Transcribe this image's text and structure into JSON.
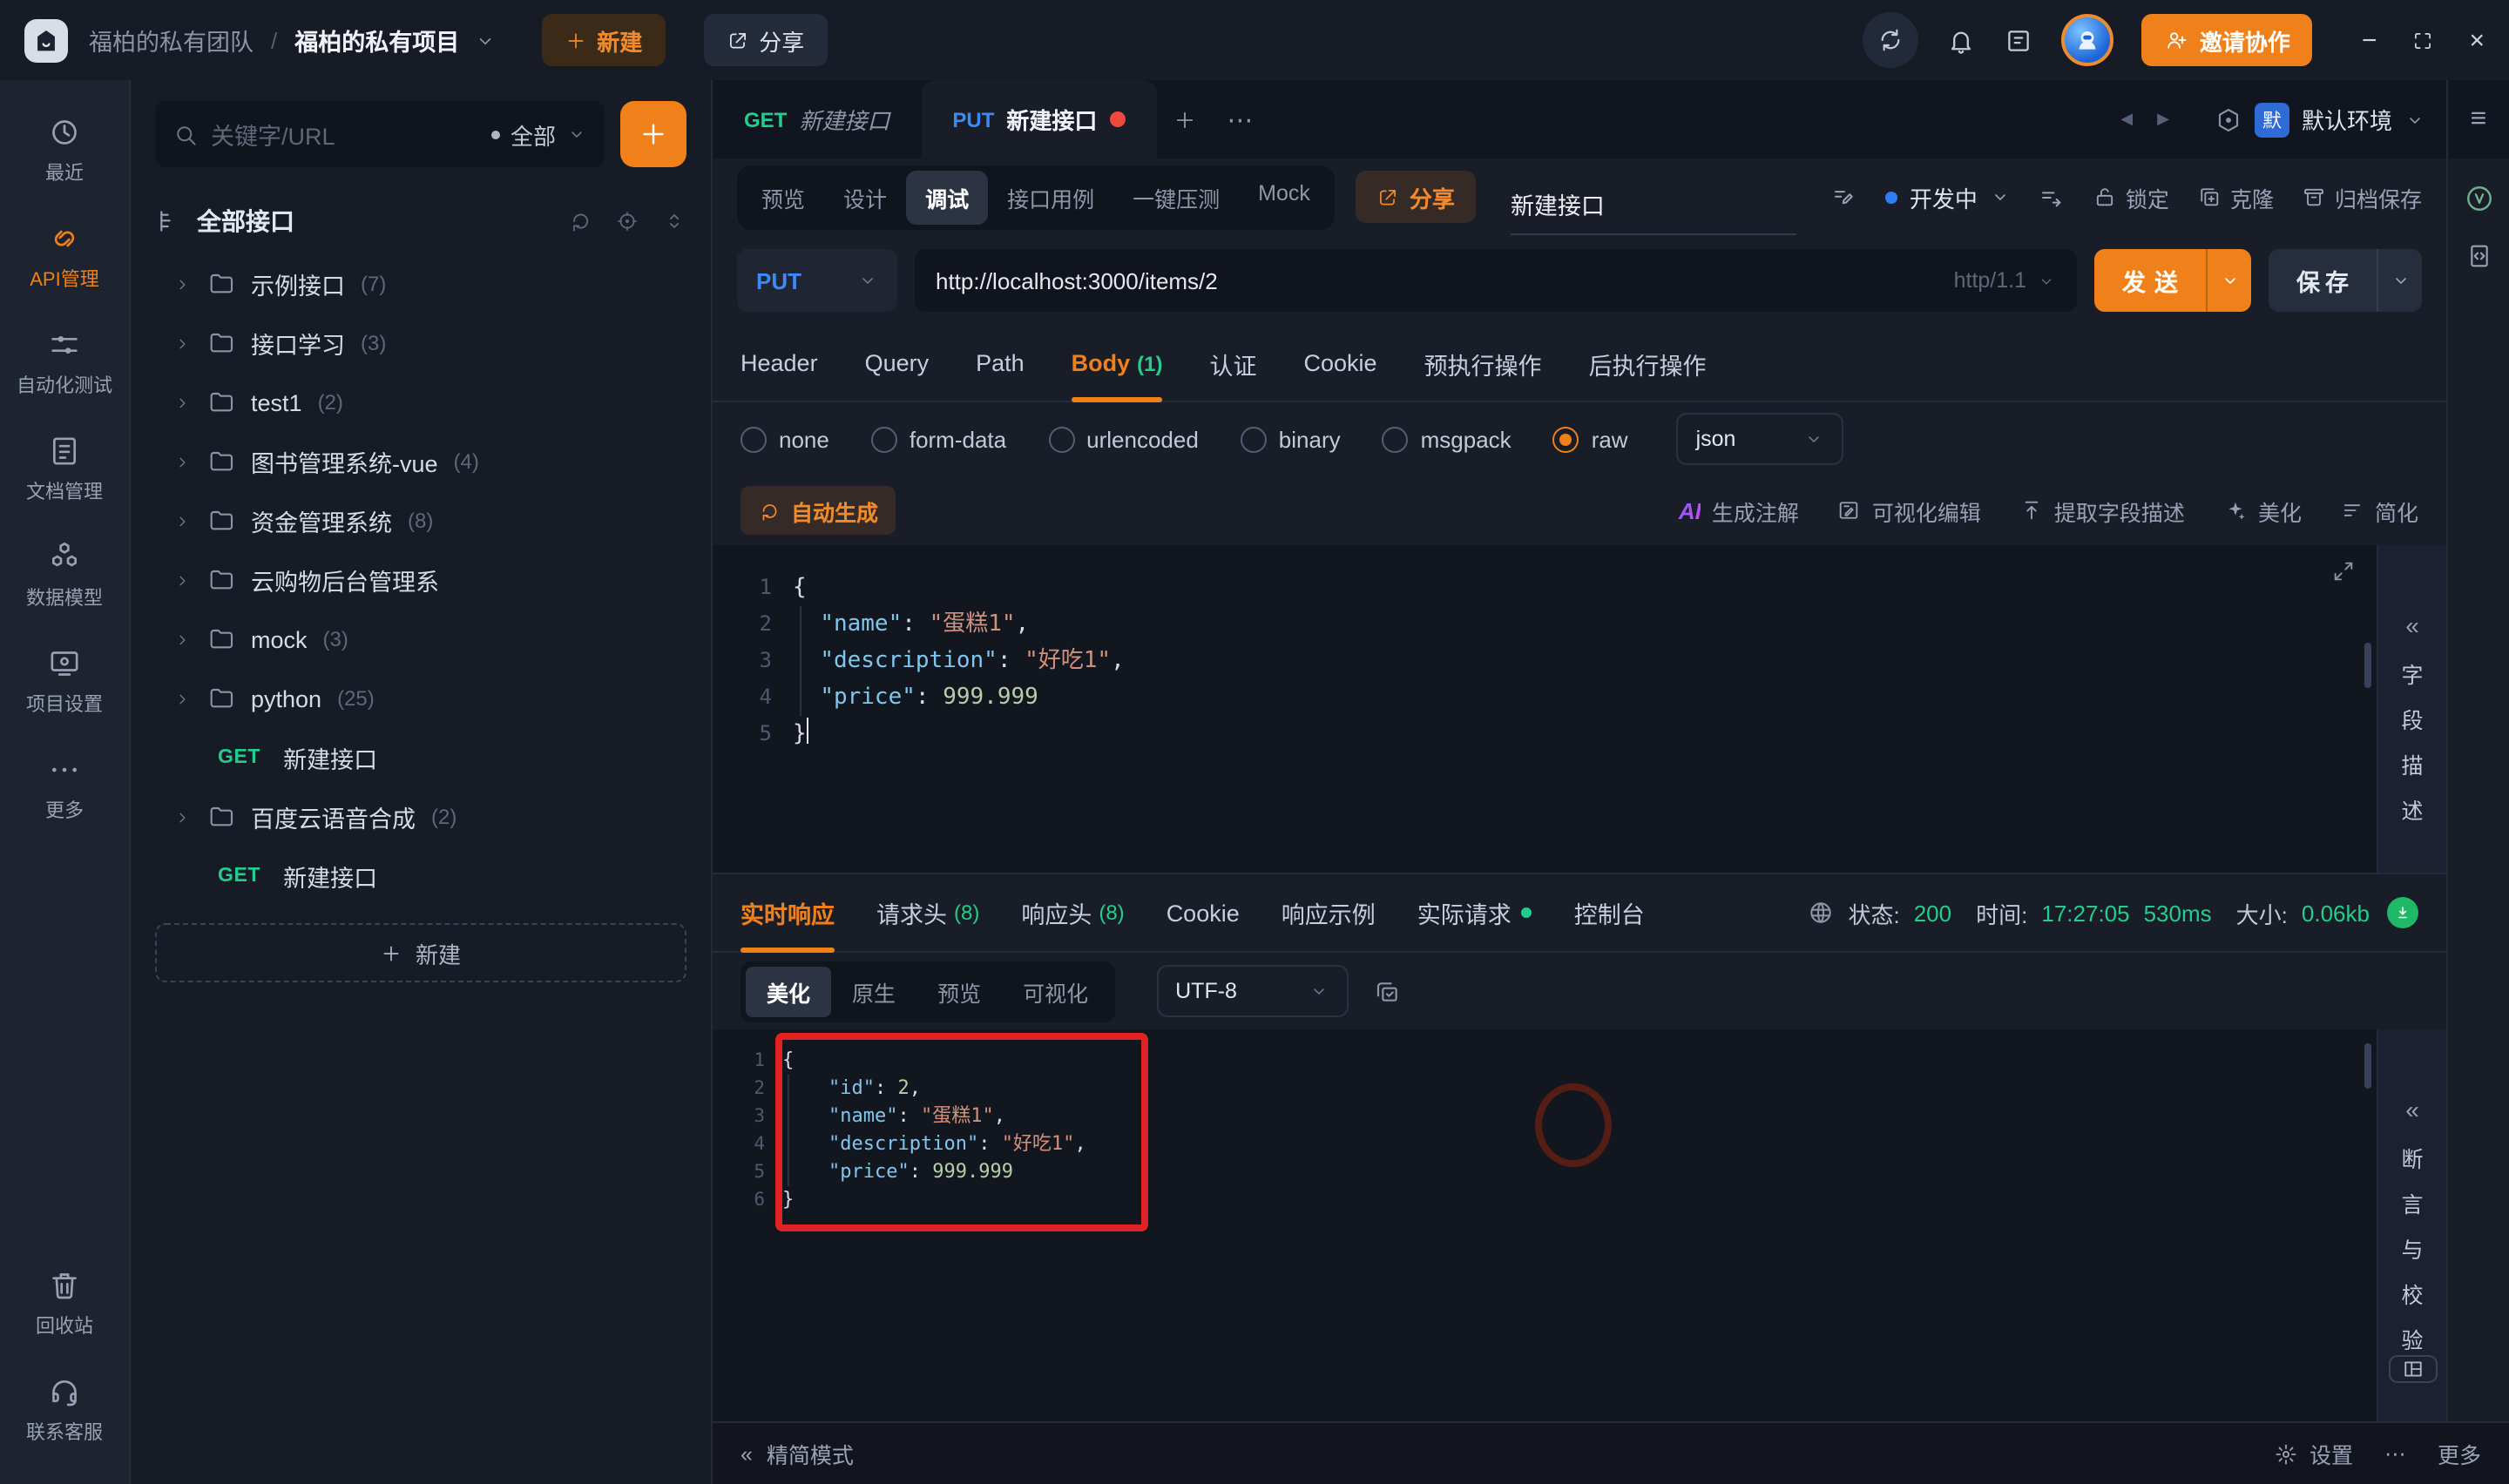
{
  "colors": {
    "accent_orange": "#F0801A",
    "method_get_green": "#23CE8C",
    "method_put_blue": "#3B8AF7",
    "success_green": "#23CE8C",
    "tab_dirty_red": "#F0483E",
    "annotation_red": "#E02222",
    "env_badge_blue": "#2E6BD6"
  },
  "topbar": {
    "team": "福柏的私有团队",
    "separator": "/",
    "project": "福柏的私有项目",
    "new_button": "新建",
    "share_button": "分享",
    "invite_button": "邀请协作"
  },
  "rail": {
    "items": [
      {
        "icon": "clock",
        "label": "最近",
        "active": false
      },
      {
        "icon": "api",
        "label": "API管理",
        "active": true
      },
      {
        "icon": "test",
        "label": "自动化测试",
        "active": false
      },
      {
        "icon": "doc",
        "label": "文档管理",
        "active": false
      },
      {
        "icon": "model",
        "label": "数据模型",
        "active": false
      },
      {
        "icon": "settings",
        "label": "项目设置",
        "active": false
      },
      {
        "icon": "dots",
        "label": "更多",
        "active": false
      }
    ],
    "bottom_items": [
      {
        "icon": "trash",
        "label": "回收站"
      },
      {
        "icon": "headset",
        "label": "联系客服"
      }
    ]
  },
  "sidebar": {
    "search_placeholder": "关键字/URL",
    "filter": "全部",
    "tree_header": "全部接口",
    "items": [
      {
        "kind": "folder",
        "name": "示例接口",
        "count": "(7)"
      },
      {
        "kind": "folder",
        "name": "接口学习",
        "count": "(3)"
      },
      {
        "kind": "folder",
        "name": "test1",
        "count": "(2)"
      },
      {
        "kind": "folder",
        "name": "图书管理系统-vue",
        "count": "(4)"
      },
      {
        "kind": "folder",
        "name": "资金管理系统",
        "count": "(8)"
      },
      {
        "kind": "folder",
        "name": "云购物后台管理系",
        "count": ""
      },
      {
        "kind": "folder",
        "name": "mock",
        "count": "(3)"
      },
      {
        "kind": "folder",
        "name": "python",
        "count": "(25)"
      },
      {
        "kind": "api",
        "method": "GET",
        "name": "新建接口"
      },
      {
        "kind": "folder",
        "name": "百度云语音合成",
        "count": "(2)"
      },
      {
        "kind": "api",
        "method": "GET",
        "name": "新建接口"
      }
    ],
    "new_button": "新建"
  },
  "tabs": {
    "open": [
      {
        "method": "GET",
        "label": "新建接口",
        "active": false,
        "dirty": false
      },
      {
        "method": "PUT",
        "label": "新建接口",
        "active": true,
        "dirty": true
      }
    ],
    "environment": {
      "badge": "默",
      "label": "默认环境"
    }
  },
  "toolbar": {
    "modes": [
      "预览",
      "设计",
      "调试",
      "接口用例",
      "一键压测",
      "Mock"
    ],
    "active_mode": "调试",
    "share": "分享",
    "title": "新建接口",
    "status": "开发中",
    "actions": [
      {
        "icon": "lock",
        "label": "锁定"
      },
      {
        "icon": "clone",
        "label": "克隆"
      },
      {
        "icon": "archive",
        "label": "归档保存"
      }
    ]
  },
  "request": {
    "method": "PUT",
    "url": "http://localhost:3000/items/2",
    "http_version": "http/1.1",
    "send": "发送",
    "save": "保存",
    "tabs": [
      {
        "label": "Header",
        "count": "",
        "active": false
      },
      {
        "label": "Query",
        "count": "",
        "active": false
      },
      {
        "label": "Path",
        "count": "",
        "active": false
      },
      {
        "label": "Body",
        "count": "(1)",
        "active": true
      },
      {
        "label": "认证",
        "count": "",
        "active": false
      },
      {
        "label": "Cookie",
        "count": "",
        "active": false
      },
      {
        "label": "预执行操作",
        "count": "",
        "active": false
      },
      {
        "label": "后执行操作",
        "count": "",
        "active": false
      }
    ],
    "body_types": [
      "none",
      "form-data",
      "urlencoded",
      "binary",
      "msgpack",
      "raw"
    ],
    "selected_body_type": "raw",
    "format": "json",
    "autogen": "自动生成",
    "editor_actions": [
      {
        "icon": "ai",
        "label": "生成注解"
      },
      {
        "icon": "visual",
        "label": "可视化编辑"
      },
      {
        "icon": "extract",
        "label": "提取字段描述"
      },
      {
        "icon": "beautify",
        "label": "美化"
      },
      {
        "icon": "simplify",
        "label": "简化"
      }
    ],
    "code_lines": [
      [
        {
          "t": "{",
          "c": "p"
        }
      ],
      [
        {
          "t": "  ",
          "c": "p"
        },
        {
          "t": "\"name\"",
          "c": "k"
        },
        {
          "t": ": ",
          "c": "p"
        },
        {
          "t": "\"蛋糕1\"",
          "c": "s"
        },
        {
          "t": ",",
          "c": "p"
        }
      ],
      [
        {
          "t": "  ",
          "c": "p"
        },
        {
          "t": "\"description\"",
          "c": "k"
        },
        {
          "t": ": ",
          "c": "p"
        },
        {
          "t": "\"好吃1\"",
          "c": "s"
        },
        {
          "t": ",",
          "c": "p"
        }
      ],
      [
        {
          "t": "  ",
          "c": "p"
        },
        {
          "t": "\"price\"",
          "c": "k"
        },
        {
          "t": ": ",
          "c": "p"
        },
        {
          "t": "999.999",
          "c": "n"
        }
      ],
      [
        {
          "t": "}",
          "c": "p"
        }
      ]
    ],
    "cursor_line": 5
  },
  "field_panel": {
    "collapse": "«",
    "label": "字段描述"
  },
  "response": {
    "tabs": [
      {
        "label": "实时响应",
        "count": "",
        "active": true,
        "dot": false
      },
      {
        "label": "请求头",
        "count": "(8)",
        "active": false,
        "dot": false
      },
      {
        "label": "响应头",
        "count": "(8)",
        "active": false,
        "dot": false
      },
      {
        "label": "Cookie",
        "count": "",
        "active": false,
        "dot": false
      },
      {
        "label": "响应示例",
        "count": "",
        "active": false,
        "dot": false
      },
      {
        "label": "实际请求",
        "count": "",
        "active": false,
        "dot": true
      },
      {
        "label": "控制台",
        "count": "",
        "active": false,
        "dot": false
      }
    ],
    "status": {
      "status_label": "状态:",
      "status_value": "200",
      "time_label": "时间:",
      "time_value": "17:27:05",
      "duration": "530ms",
      "size_label": "大小:",
      "size_value": "0.06kb"
    },
    "view_modes": [
      "美化",
      "原生",
      "预览",
      "可视化"
    ],
    "active_view": "美化",
    "encoding": "UTF-8",
    "code_lines": [
      [
        {
          "t": "{",
          "c": "p"
        }
      ],
      [
        {
          "t": "    ",
          "c": "p"
        },
        {
          "t": "\"id\"",
          "c": "k"
        },
        {
          "t": ": ",
          "c": "p"
        },
        {
          "t": "2",
          "c": "n"
        },
        {
          "t": ",",
          "c": "p"
        }
      ],
      [
        {
          "t": "    ",
          "c": "p"
        },
        {
          "t": "\"name\"",
          "c": "k"
        },
        {
          "t": ": ",
          "c": "p"
        },
        {
          "t": "\"蛋糕1\"",
          "c": "s"
        },
        {
          "t": ",",
          "c": "p"
        }
      ],
      [
        {
          "t": "    ",
          "c": "p"
        },
        {
          "t": "\"description\"",
          "c": "k"
        },
        {
          "t": ": ",
          "c": "p"
        },
        {
          "t": "\"好吃1\"",
          "c": "s"
        },
        {
          "t": ",",
          "c": "p"
        }
      ],
      [
        {
          "t": "    ",
          "c": "p"
        },
        {
          "t": "\"price\"",
          "c": "k"
        },
        {
          "t": ": ",
          "c": "p"
        },
        {
          "t": "999.999",
          "c": "n"
        }
      ],
      [
        {
          "t": "}",
          "c": "p"
        }
      ]
    ]
  },
  "assert_panel": {
    "collapse": "«",
    "label": "断言与校验"
  },
  "bottombar": {
    "collapse": "«",
    "simple_mode": "精简模式",
    "settings": "设置",
    "more": "更多"
  }
}
